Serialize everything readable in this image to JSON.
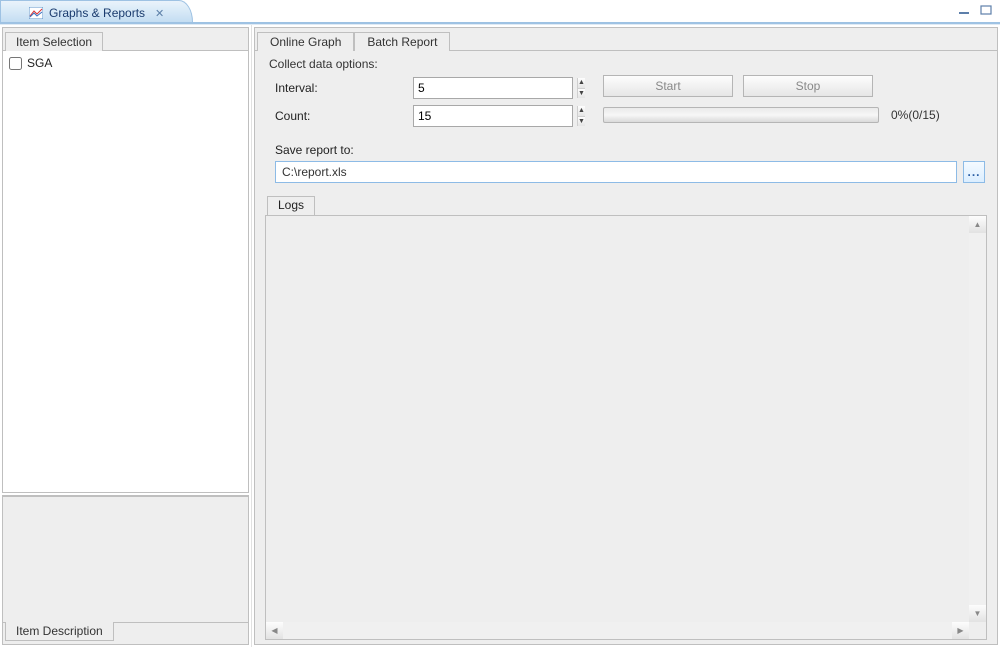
{
  "view_tab": {
    "title": "Graphs & Reports"
  },
  "left": {
    "item_selection_label": "Item Selection",
    "tree_items": [
      {
        "label": "SGA",
        "checked": false
      }
    ],
    "item_description_label": "Item Description"
  },
  "right": {
    "tabs": {
      "online_graph": "Online Graph",
      "batch_report": "Batch Report",
      "active": "batch_report"
    },
    "collect": {
      "group_label": "Collect data options:",
      "interval_label": "Interval:",
      "interval_value": "5",
      "count_label": "Count:",
      "count_value": "15",
      "start_label": "Start",
      "stop_label": "Stop",
      "progress_text": "0%(0/15)"
    },
    "save": {
      "label": "Save report to:",
      "path": "C:\\report.xls",
      "browse_label": "..."
    },
    "logs": {
      "tab_label": "Logs"
    }
  }
}
